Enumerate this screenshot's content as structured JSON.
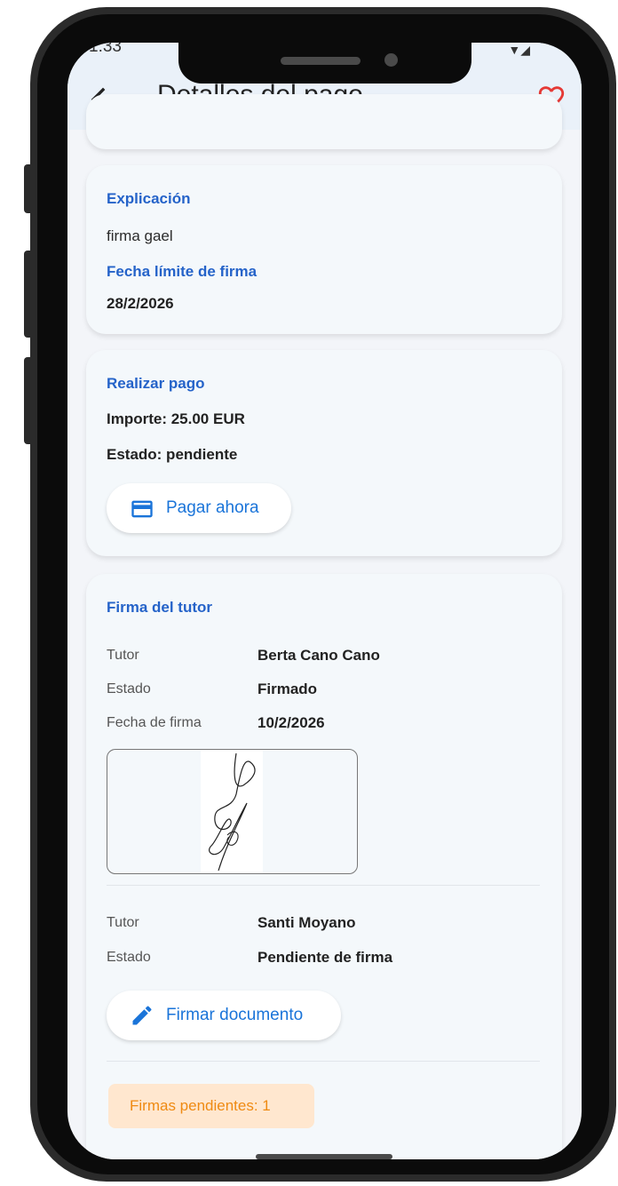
{
  "status_bar": {
    "time": "1:33",
    "icons_right": "▼◢"
  },
  "app_bar": {
    "title": "Detalles del pago",
    "back_icon": "arrow-left-icon",
    "favorite_icon": "heart-outline-icon"
  },
  "explanation_card": {
    "explanation_label": "Explicación",
    "explanation_value": "firma gael",
    "deadline_label": "Fecha límite de firma",
    "deadline_value": "28/2/2026"
  },
  "payment_card": {
    "title": "Realizar pago",
    "amount": "Importe: 25.00 EUR",
    "status": "Estado: pendiente",
    "pay_button_label": "Pagar ahora",
    "pay_icon": "credit-card-icon"
  },
  "tutor_signature_card": {
    "title": "Firma del tutor",
    "signers": [
      {
        "tutor_key": "Tutor",
        "tutor_value": "Berta Cano Cano",
        "state_key": "Estado",
        "state_value": "Firmado",
        "date_key": "Fecha de firma",
        "date_value": "10/2/2026"
      },
      {
        "tutor_key": "Tutor",
        "tutor_value": "Santi Moyano",
        "state_key": "Estado",
        "state_value": "Pendiente de firma"
      }
    ],
    "sign_button_label": "Firmar documento",
    "sign_icon": "pencil-icon",
    "pending_badge": "Firmas pendientes: 1"
  },
  "colors": {
    "accent_blue": "#2563c9",
    "button_blue": "#1a74d9",
    "badge_bg": "#ffe7cf",
    "badge_text": "#ef8a12",
    "heart_red": "#e53935"
  }
}
